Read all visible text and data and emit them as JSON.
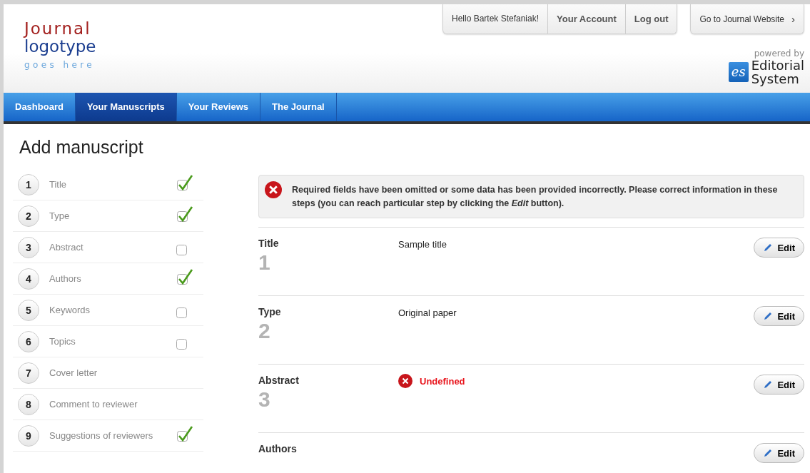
{
  "logo": {
    "line1": "Journal",
    "line2": "logotype",
    "line3": "goes here"
  },
  "user_bar": {
    "greeting": "Hello Bartek Stefaniak!",
    "links": [
      "Your Account",
      "Log out"
    ],
    "website": "Go to Journal Website",
    "website_arrow": "›"
  },
  "powered": {
    "label": "powered by",
    "badge": "es",
    "name1": "Editorial",
    "name2": "System"
  },
  "nav": [
    {
      "label": "Dashboard",
      "selected": false
    },
    {
      "label": "Your Manuscripts",
      "selected": true
    },
    {
      "label": "Your Reviews",
      "selected": false
    },
    {
      "label": "The Journal",
      "selected": false
    }
  ],
  "page_title": "Add manuscript",
  "steps": [
    {
      "number": "1",
      "label": "Title",
      "kind": "checkbox",
      "checked": true
    },
    {
      "number": "2",
      "label": "Type",
      "kind": "checkbox",
      "checked": true
    },
    {
      "number": "3",
      "label": "Abstract",
      "kind": "checkbox",
      "checked": false
    },
    {
      "number": "4",
      "label": "Authors",
      "kind": "checkbox",
      "checked": true
    },
    {
      "number": "5",
      "label": "Keywords",
      "kind": "checkbox",
      "checked": false
    },
    {
      "number": "6",
      "label": "Topics",
      "kind": "checkbox",
      "checked": false
    },
    {
      "number": "7",
      "label": "Cover letter",
      "kind": "plain"
    },
    {
      "number": "8",
      "label": "Comment to reviewer",
      "kind": "plain"
    },
    {
      "number": "9",
      "label": "Suggestions of reviewers",
      "kind": "checkbox",
      "checked": true
    }
  ],
  "alert": "Required fields have been omitted or some data has been provided incorrectly. Please correct information in these steps (you can reach particular step by clicking the *Edit* button).",
  "sections": [
    {
      "title": "Title",
      "number": "1",
      "kind": "text",
      "value": "Sample title",
      "button": "Edit"
    },
    {
      "title": "Type",
      "number": "2",
      "kind": "text",
      "value": "Original paper",
      "button": "Edit"
    },
    {
      "title": "Abstract",
      "number": "3",
      "kind": "error",
      "value": "Undefined",
      "button": "Edit"
    },
    {
      "title": "Authors",
      "kind": "empty",
      "button": "Edit"
    }
  ]
}
